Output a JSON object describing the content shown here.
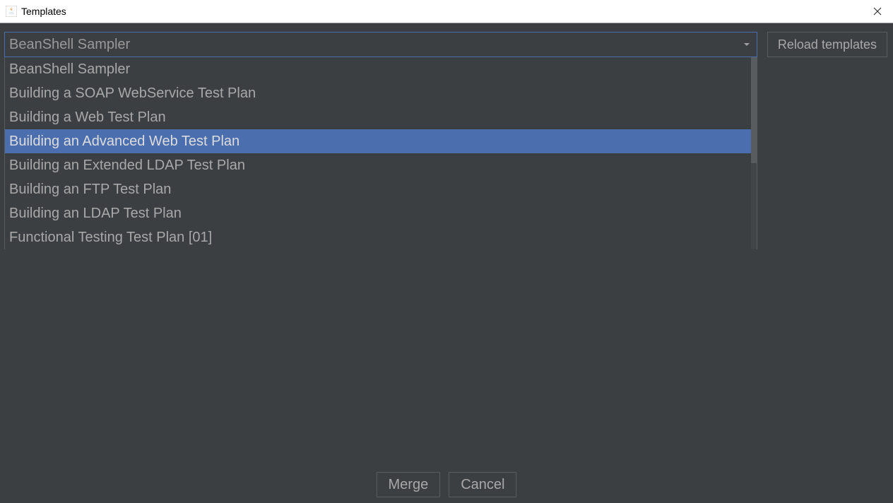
{
  "window": {
    "title": "Templates"
  },
  "combo": {
    "selected": "BeanShell Sampler"
  },
  "buttons": {
    "reload": "Reload templates",
    "merge": "Merge",
    "cancel": "Cancel"
  },
  "options": [
    "BeanShell Sampler",
    "Building a SOAP WebService Test Plan",
    "Building a Web Test Plan",
    "Building an Advanced Web Test Plan",
    "Building an Extended LDAP Test Plan",
    "Building an FTP Test Plan",
    "Building an LDAP Test Plan",
    "Functional Testing Test Plan [01]"
  ],
  "highlighted_index": 3
}
